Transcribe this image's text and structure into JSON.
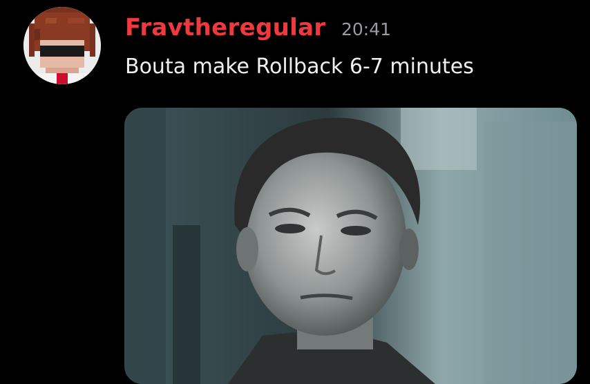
{
  "message": {
    "author": "Fravtheregular",
    "author_color": "#ee3a3f",
    "timestamp": "20:41",
    "text": "Bouta make Rollback 6-7 minutes",
    "avatar_icon": "pixel-art-avatar",
    "attachment_icon": "gif-thumbnail-icon"
  }
}
